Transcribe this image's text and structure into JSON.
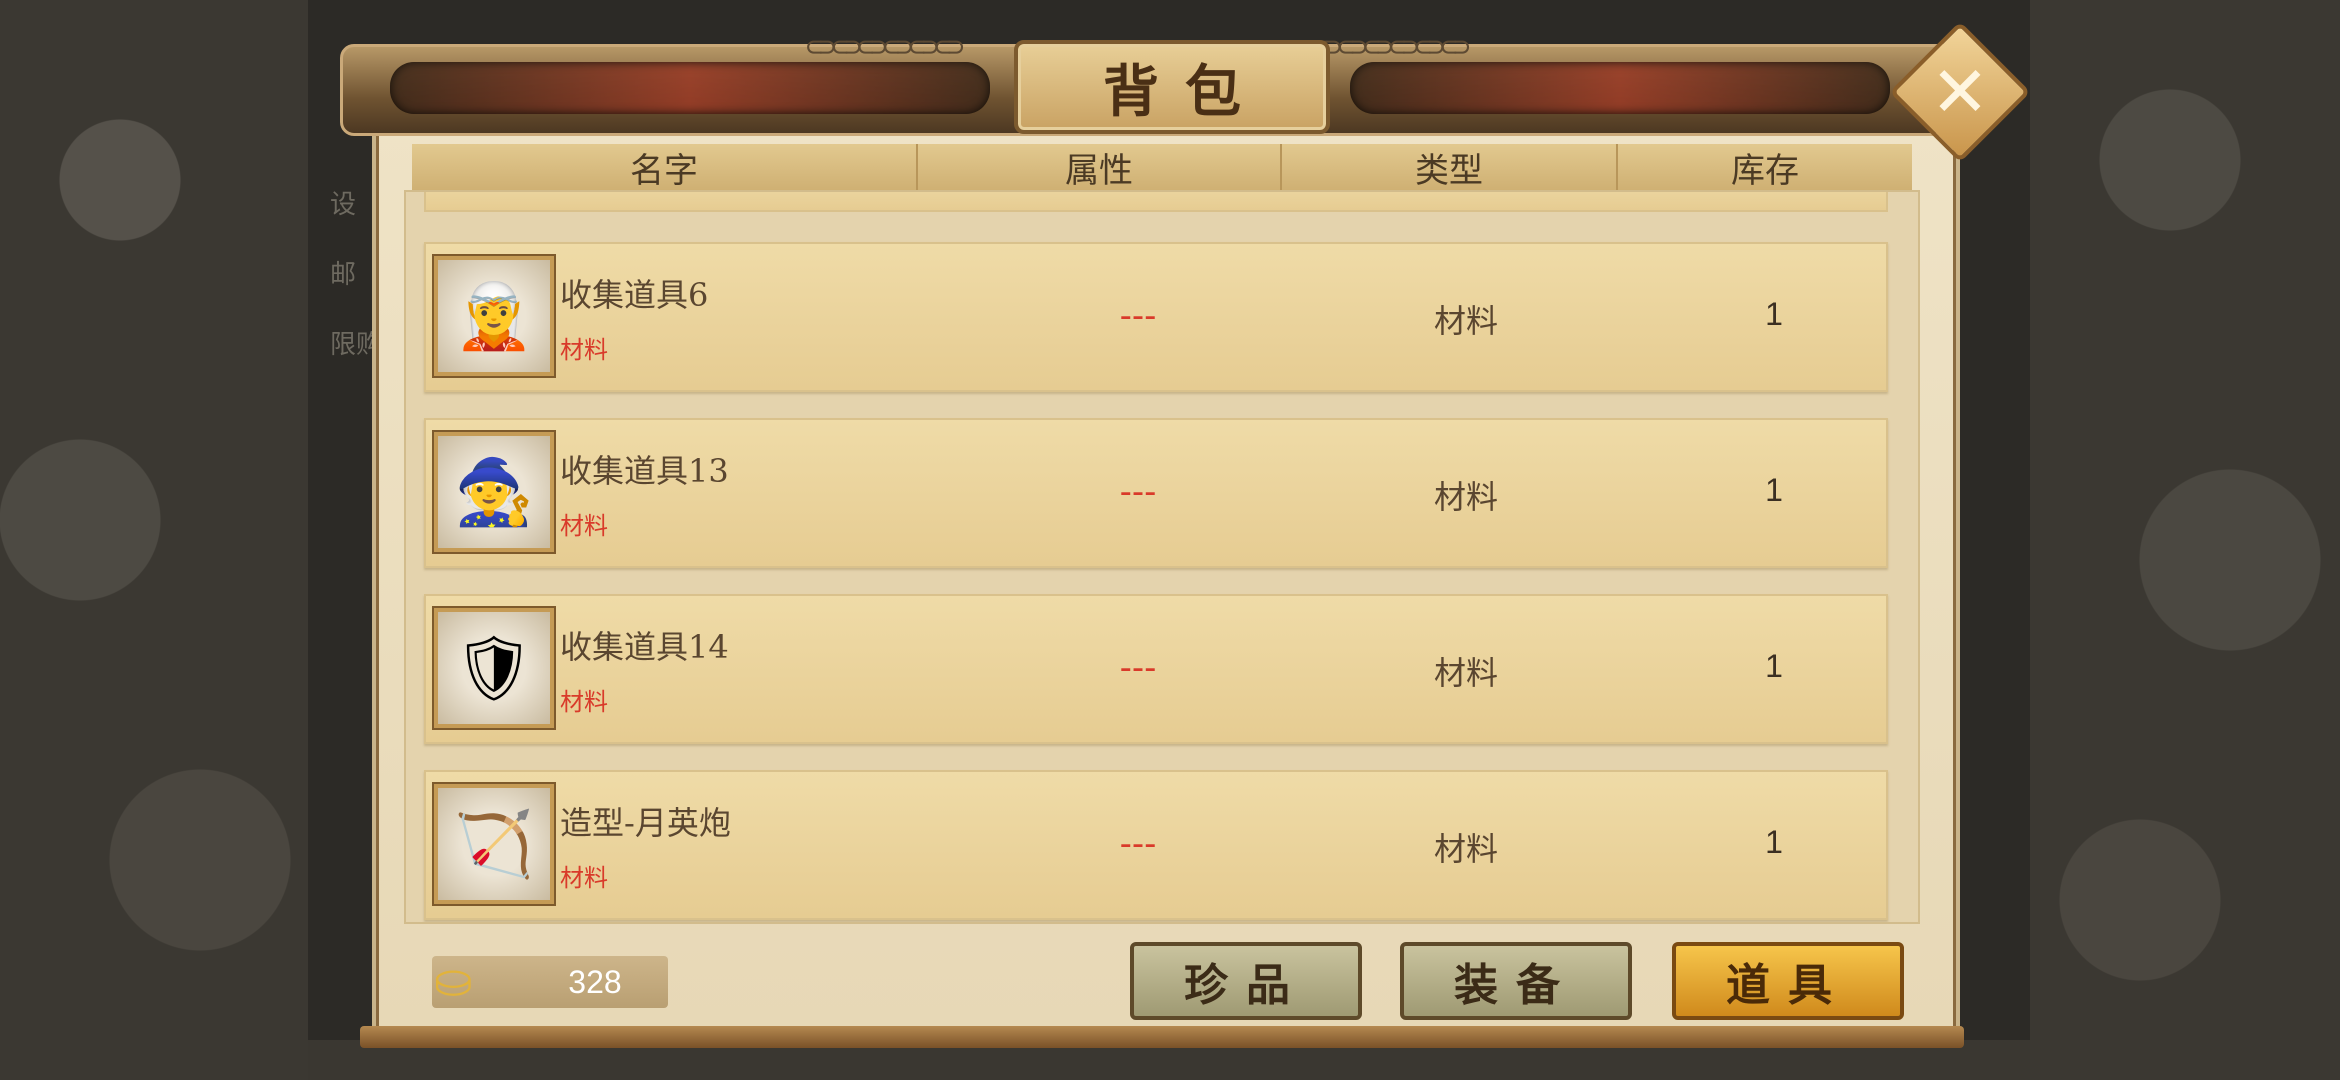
{
  "background": {
    "left_labels": [
      "设",
      "邮",
      "限购"
    ]
  },
  "window": {
    "title": "背包",
    "close_label": "✕"
  },
  "columns": [
    "名字",
    "属性",
    "类型",
    "库存"
  ],
  "items": [
    {
      "name": "收集道具6",
      "subtype": "材料",
      "attribute": "---",
      "type": "材料",
      "stock": "1",
      "icon": "ice-warrior-icon",
      "glyph": "🧝"
    },
    {
      "name": "收集道具13",
      "subtype": "材料",
      "attribute": "---",
      "type": "材料",
      "stock": "1",
      "icon": "robed-general-icon",
      "glyph": "🧙"
    },
    {
      "name": "收集道具14",
      "subtype": "材料",
      "attribute": "---",
      "type": "材料",
      "stock": "1",
      "icon": "golden-armored-warrior-icon",
      "glyph": "🛡"
    },
    {
      "name": "造型-月英炮",
      "subtype": "材料",
      "attribute": "---",
      "type": "材料",
      "stock": "1",
      "icon": "siege-cannon-icon",
      "glyph": "🏹"
    }
  ],
  "footer": {
    "gold_value": "328",
    "tabs": [
      {
        "label": "珍品",
        "active": false
      },
      {
        "label": "装备",
        "active": false
      },
      {
        "label": "道具",
        "active": true
      }
    ]
  },
  "colors": {
    "accent_gold": "#d08a1c",
    "attribute_red": "#d93a2a",
    "parchment": "#efdba7"
  }
}
